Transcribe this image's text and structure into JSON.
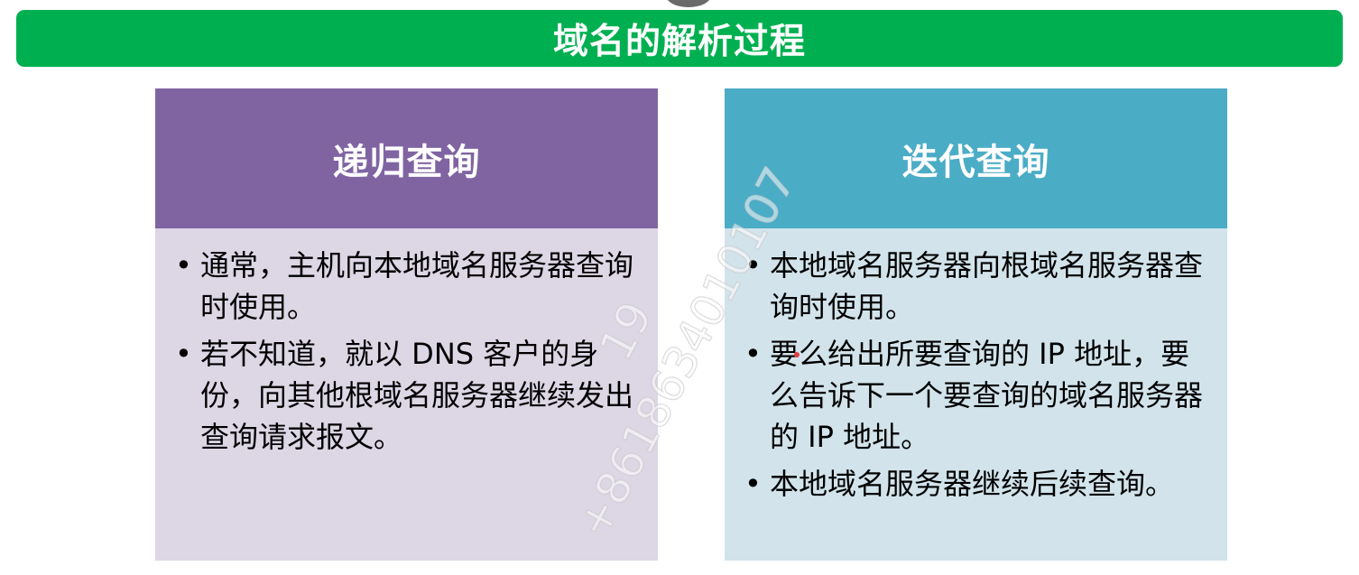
{
  "title": "域名的解析过程",
  "left_card": {
    "heading": "递归查询",
    "bullets": [
      "通常，主机向本地域名服务器查询时使用。",
      "若不知道，就以 DNS 客户的身份，向其他根域名服务器继续发出查询请求报文。"
    ],
    "header_color": "#8064a2",
    "body_color": "#dcd6e5"
  },
  "right_card": {
    "heading": "迭代查询",
    "bullets": [
      "本地域名服务器向根域名服务器查询时使用。",
      "要么给出所要查询的 IP 地址，要么告诉下一个要查询的域名服务器的 IP 地址。",
      "本地域名服务器继续后续查询。"
    ],
    "header_color": "#4bacc6",
    "body_color": "#d2e3eb"
  },
  "watermark": {
    "line1": "19",
    "line2": "+8618634010107"
  },
  "accent_color": "#00b050"
}
